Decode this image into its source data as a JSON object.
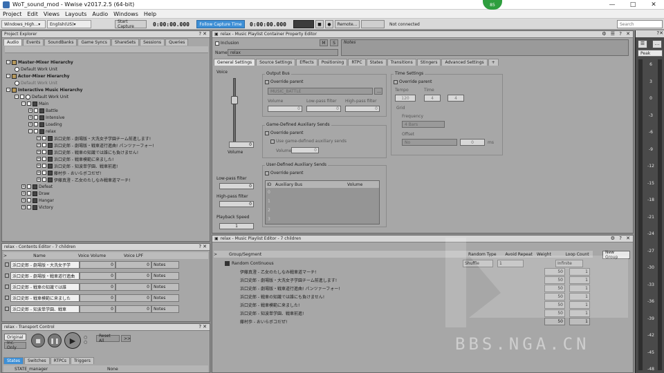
{
  "window": {
    "title": "WoT_sound_mod - Wwise v2017.2.5 (64-bit)",
    "badge": "85"
  },
  "menu": [
    "Project",
    "Edit",
    "Views",
    "Layouts",
    "Audio",
    "Windows",
    "Help"
  ],
  "toolbar": {
    "platform": "Windows_High...",
    "language": "English(US)",
    "start_capture": "Start Capture",
    "capture_time": "0:00:00.000",
    "follow_capture": "Follow Capture Time",
    "time2": "0:00:00.000",
    "remote": "Remote...",
    "connection": "Not connected",
    "search": "Search"
  },
  "project_explorer": {
    "title": "Project Explorer",
    "tabs": [
      "Audio",
      "Events",
      "SoundBanks",
      "Game Syncs",
      "ShareSets",
      "Sessions",
      "Queries"
    ],
    "rows": [
      {
        "label": "Master-Mixer Hierarchy",
        "bold": true
      },
      {
        "label": "Default Work Unit"
      },
      {
        "label": "Actor-Mixer Hierarchy",
        "bold": true
      },
      {
        "label": "Default Work Unit"
      },
      {
        "label": "Interactive Music Hierarchy",
        "bold": true
      },
      {
        "label": "Default Work Unit"
      },
      {
        "label": "Main"
      },
      {
        "label": "Battle"
      },
      {
        "label": "Intensive"
      },
      {
        "label": "Loading"
      },
      {
        "label": "relax"
      },
      {
        "label": "浜口史郎 - 劇場版・大洗女子学園チーム前進します!"
      },
      {
        "label": "浜口史郎 - 劇場版・戦車道行進曲! パンツァーフォー!"
      },
      {
        "label": "浜口史郎 - 戦車の知識では誰にも負けません!"
      },
      {
        "label": "浜口史郎 - 戦車模範に来ました!"
      },
      {
        "label": "浜口史郎 - 知波単学園、戦車前進!"
      },
      {
        "label": "藤村歩 - おいらボコだぜ!"
      },
      {
        "label": "伊藤真澄 - 乙女のたしなみ戦車道マーチ!"
      },
      {
        "label": "Defeat"
      },
      {
        "label": "Draw"
      },
      {
        "label": "Hangar"
      },
      {
        "label": "Victory"
      }
    ]
  },
  "contents_editor": {
    "title": "relax - Contents Editor - 7 children",
    "columns": [
      "Name",
      "Voice Volume",
      "Voice LPF"
    ],
    "rows": [
      {
        "name": "浜口史郎 - 劇場版・大洗女子学",
        "volume": "0",
        "lpf": "0",
        "notes": "Notes"
      },
      {
        "name": "浜口史郎 - 劇場版・戦車道行進曲",
        "volume": "0",
        "lpf": "0",
        "notes": "Notes"
      },
      {
        "name": "浜口史郎 - 戦車の知識では誰",
        "volume": "0",
        "lpf": "0",
        "notes": "Notes"
      },
      {
        "name": "浜口史郎 - 戦車模範に来ました",
        "volume": "0",
        "lpf": "0",
        "notes": "Notes"
      },
      {
        "name": "浜口史郎 - 知波単学園、戦車",
        "volume": "0",
        "lpf": "0",
        "notes": "Notes"
      }
    ]
  },
  "transport": {
    "title": "relax - Transport Control",
    "original": "Original",
    "inc_only": "Inc. Only",
    "reset_all": "Reset All",
    "more": ">>",
    "tabs": [
      "States",
      "Switches",
      "RTPCs",
      "Triggers"
    ],
    "state_col": "STATE_manager",
    "state_val": "None"
  },
  "property_editor": {
    "title": "relax - Music Playlist Container Property Editor",
    "inclusion": "Inclusion",
    "name_label": "Name",
    "name_value": "relax",
    "notes": "Notes",
    "m": "M",
    "s": "S",
    "tabs": [
      "General Settings",
      "Source Settings",
      "Effects",
      "Positioning",
      "RTPC",
      "States",
      "Transitions",
      "Stingers",
      "Advanced Settings",
      "+"
    ],
    "voice": "Voice",
    "volume_label": "Volume",
    "volume_value": "0",
    "lowpass": "Low-pass filter",
    "lowpass_value": "0",
    "highpass": "High-pass filter",
    "highpass_value": "0",
    "playback_speed": "Playback Speed",
    "playback_value": "1",
    "output_bus": "Output Bus",
    "override_parent": "Override parent",
    "bus_name": "MUSIC_BATTLE",
    "ob_cols": [
      "Volume",
      "Low-pass filter",
      "High-pass filter"
    ],
    "ob_vals": [
      "0",
      "0",
      "0"
    ],
    "game_aux": "Game-Defined Auxiliary Sends",
    "use_game_aux": "Use game-defined auxiliary sends",
    "gaux_volume": "Volume",
    "gaux_value": "0",
    "user_aux": "User-Defined Auxiliary Sends",
    "aux_cols": [
      "ID",
      "Auxiliary Bus",
      "Volume"
    ],
    "aux_ids": [
      "0",
      "1",
      "2",
      "3"
    ],
    "time_settings": "Time Settings",
    "tempo": "Tempo",
    "tempo_val": "120",
    "time": "Time",
    "time_num": "4",
    "time_den": "4",
    "grid": "Grid",
    "frequency": "Frequency",
    "freq_val": "4 Bars",
    "offset": "Offset",
    "offset_val": "No",
    "offset_num": "0",
    "offset_unit": "ms"
  },
  "playlist_editor": {
    "title": "relax - Music Playlist Editor - 7 children",
    "columns": [
      "Group/Segment",
      "Random Type",
      "Avoid Repeat",
      "Weight",
      "Loop Count"
    ],
    "new_group": "New Group",
    "root": {
      "name": "Random Continuous",
      "random": "Shuffle",
      "avoid": "1",
      "loop": "Infinite"
    },
    "segments": [
      {
        "name": "伊藤真澄 - 乙女のたしなみ戦車道マーチ!",
        "weight": "50",
        "loop": "1"
      },
      {
        "name": "浜口史郎 - 劇場版・大洗女子学園チーム前進します!",
        "weight": "50",
        "loop": "1"
      },
      {
        "name": "浜口史郎 - 劇場版・戦車道行進曲! パンツァーフォー!",
        "weight": "50",
        "loop": "1"
      },
      {
        "name": "浜口史郎 - 戦車の知識では誰にも負けません!",
        "weight": "50",
        "loop": "1"
      },
      {
        "name": "浜口史郎 - 戦車模範に来ました!",
        "weight": "50",
        "loop": "1"
      },
      {
        "name": "浜口史郎 - 知波単学園、戦車前進!",
        "weight": "50",
        "loop": "1"
      },
      {
        "name": "藤村歩 - おいらボコだぜ!",
        "weight": "50",
        "loop": "1"
      }
    ]
  },
  "meter": {
    "mode": "Peak",
    "scale": [
      "6",
      "3",
      "0",
      "-3",
      "-6",
      "-9",
      "-12",
      "-15",
      "-18",
      "-21",
      "-24",
      "-27",
      "-30",
      "-33",
      "-36",
      "-39",
      "-42",
      "-45",
      "-48"
    ]
  },
  "watermark": "BBS.NGA.CN"
}
